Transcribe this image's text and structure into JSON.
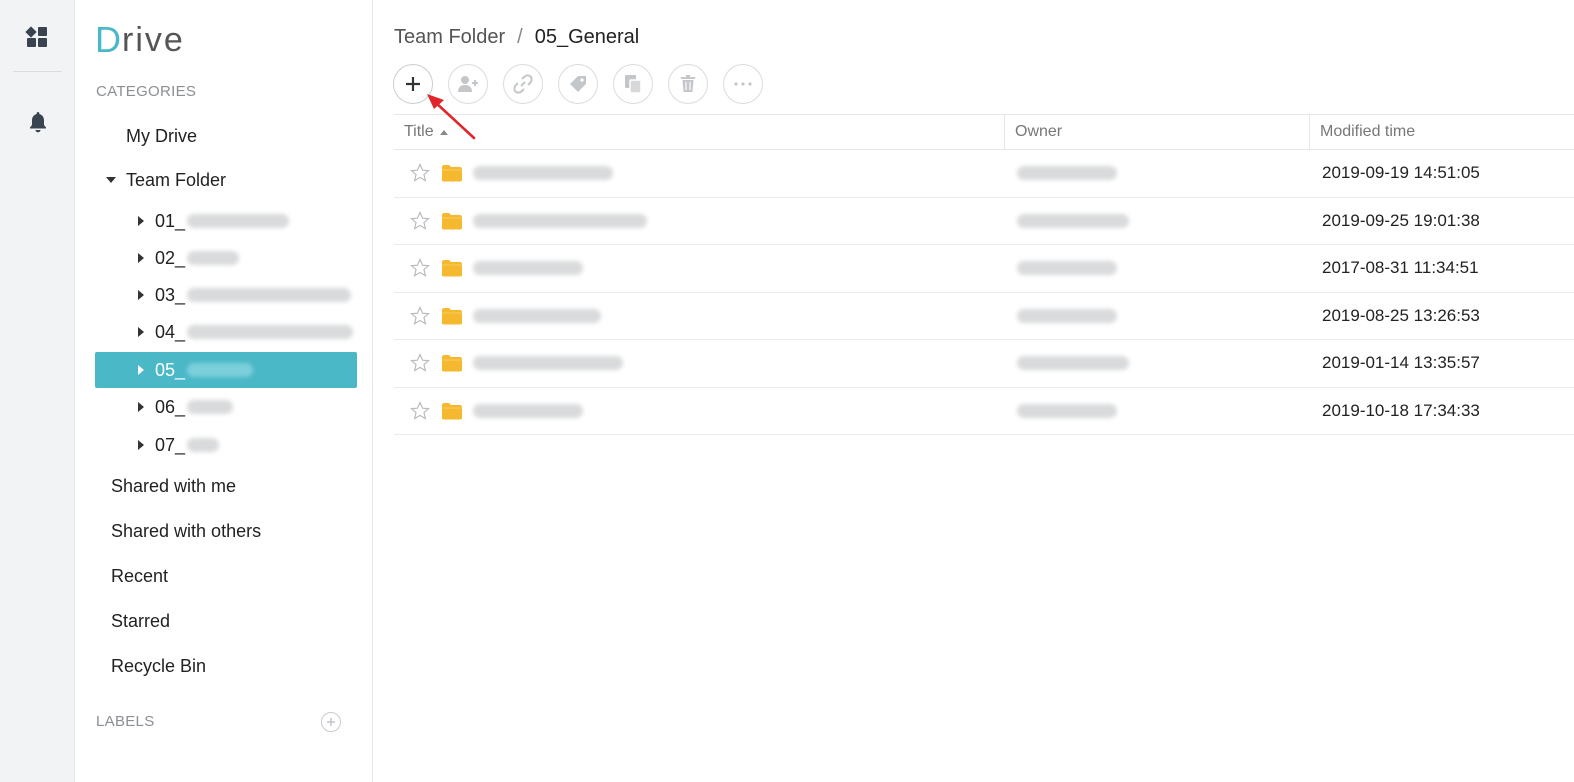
{
  "app": {
    "logo_d": "D",
    "logo_rest": "rive",
    "accent_color": "#4bb8c7",
    "folder_color": "#f5b82e"
  },
  "rail": {
    "apps_icon": "apps-grid-icon",
    "bell_icon": "bell-icon"
  },
  "sidebar": {
    "categories_label": "CATEGORIES",
    "my_drive": "My Drive",
    "team_folder": "Team Folder",
    "team_children": [
      {
        "prefix": "01_"
      },
      {
        "prefix": "02_"
      },
      {
        "prefix": "03_"
      },
      {
        "prefix": "04_"
      },
      {
        "prefix": "05_",
        "active": true
      },
      {
        "prefix": "06_"
      },
      {
        "prefix": "07_"
      }
    ],
    "shared_with_me": "Shared with me",
    "shared_with_others": "Shared with others",
    "recent": "Recent",
    "starred": "Starred",
    "recycle_bin": "Recycle Bin",
    "labels_label": "LABELS"
  },
  "breadcrumb": {
    "parent": "Team Folder",
    "separator": "/",
    "current": "05_General"
  },
  "toolbar": {
    "buttons": [
      "add-icon",
      "share-user-icon",
      "link-icon",
      "tag-icon",
      "copy-icon",
      "trash-icon",
      "more-icon"
    ]
  },
  "table": {
    "columns": {
      "title": "Title",
      "owner": "Owner",
      "modified": "Modified time"
    },
    "rows": [
      {
        "modified": "2019-09-19 14:51:05"
      },
      {
        "modified": "2019-09-25 19:01:38"
      },
      {
        "modified": "2017-08-31 11:34:51"
      },
      {
        "modified": "2019-08-25 13:26:53"
      },
      {
        "modified": "2019-01-14 13:35:57"
      },
      {
        "modified": "2019-10-18 17:34:33"
      }
    ]
  }
}
